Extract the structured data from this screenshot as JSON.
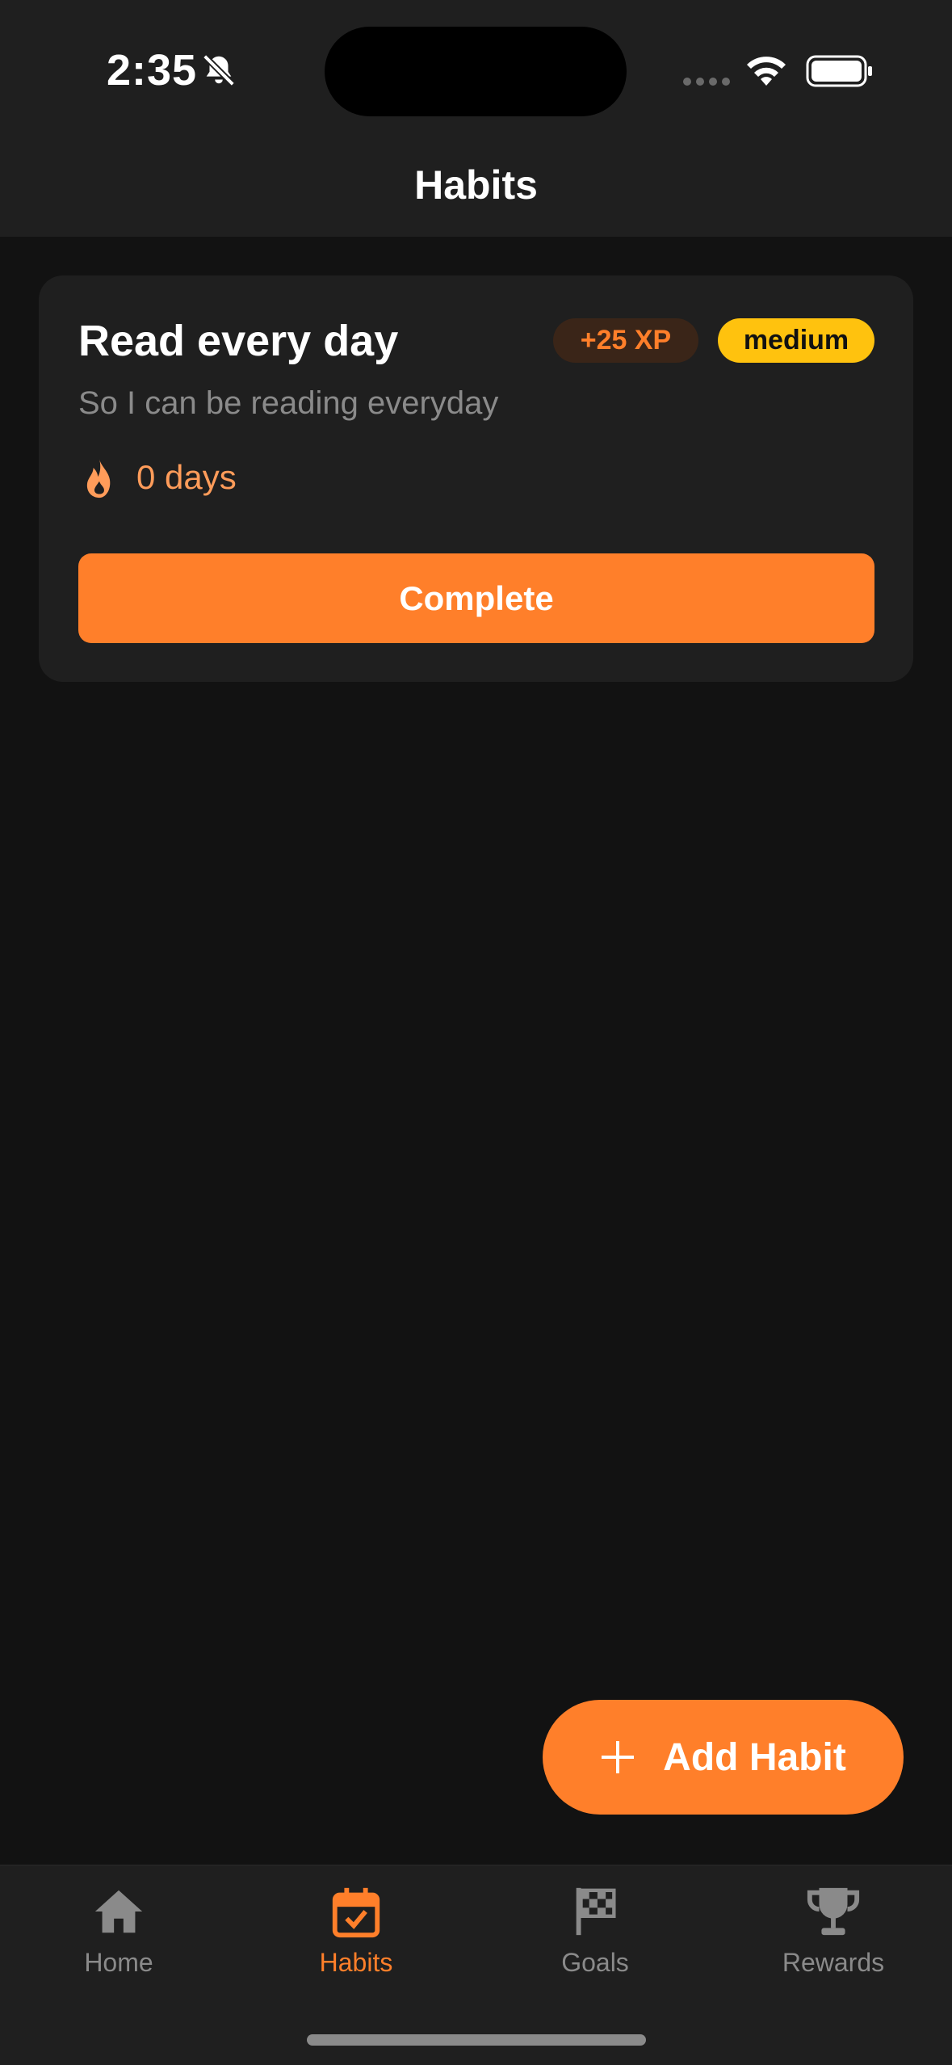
{
  "status_bar": {
    "time": "2:35",
    "icons": [
      "bell-off-icon",
      "signal-icon",
      "wifi-icon",
      "battery-icon"
    ]
  },
  "header": {
    "title": "Habits"
  },
  "habits": [
    {
      "title": "Read every day",
      "xp": "+25 XP",
      "difficulty": "medium",
      "description": "So I can be reading everyday",
      "streak": "0 days",
      "action_label": "Complete"
    }
  ],
  "fab": {
    "label": "Add Habit",
    "icon": "plus-icon"
  },
  "tab_bar": {
    "items": [
      {
        "label": "Home",
        "icon": "home-icon",
        "active": false
      },
      {
        "label": "Habits",
        "icon": "calendar-check-icon",
        "active": true
      },
      {
        "label": "Goals",
        "icon": "checkered-flag-icon",
        "active": false
      },
      {
        "label": "Rewards",
        "icon": "trophy-icon",
        "active": false
      }
    ]
  },
  "colors": {
    "accent": "#ff7f2a",
    "badge_medium": "#ffc20e",
    "background": "#121212",
    "surface": "#1f1f1f",
    "muted_text": "#8a8a8a"
  }
}
